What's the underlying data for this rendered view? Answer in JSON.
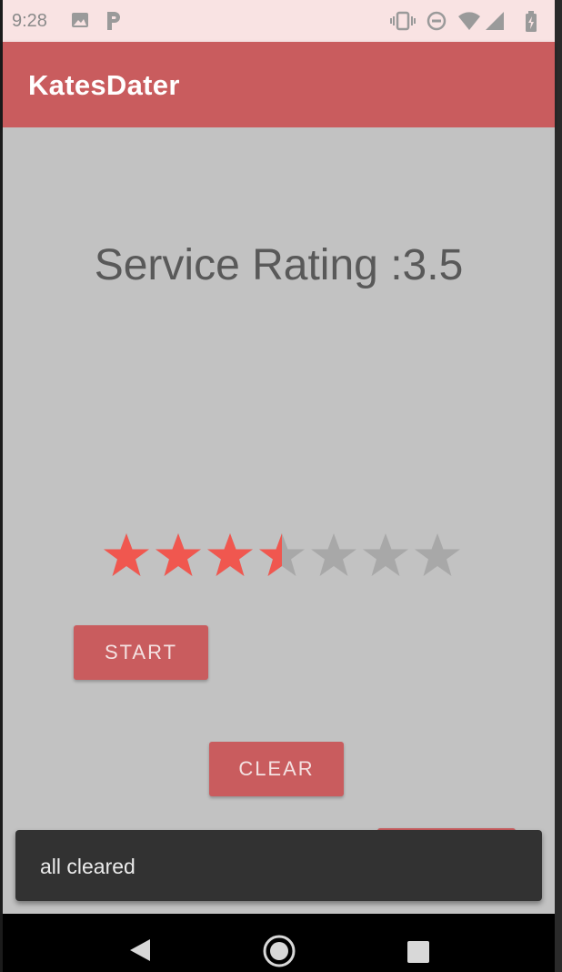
{
  "status_bar": {
    "time": "9:28",
    "left_icons": [
      "image-icon",
      "parking-icon"
    ],
    "right_icons": [
      "vibrate-icon",
      "do-not-disturb-icon",
      "wifi-icon",
      "cell-signal-icon",
      "battery-icon"
    ]
  },
  "app_bar": {
    "title": "KatesDater"
  },
  "rating": {
    "label": "Service Rating :3.5",
    "value": 3.5,
    "max": 7,
    "filled_color": "#f0574f",
    "empty_color": "#a8a8a8"
  },
  "buttons": {
    "start": "START",
    "clear": "CLEAR"
  },
  "snackbar": {
    "message": "all cleared"
  },
  "nav_bar": {
    "icons": [
      "back-icon",
      "home-icon",
      "recents-icon"
    ]
  },
  "colors": {
    "primary": "#c95c5e",
    "status_bar_bg": "#f9e3e3",
    "content_bg": "#c2c2c2",
    "snackbar_bg": "#323232"
  }
}
